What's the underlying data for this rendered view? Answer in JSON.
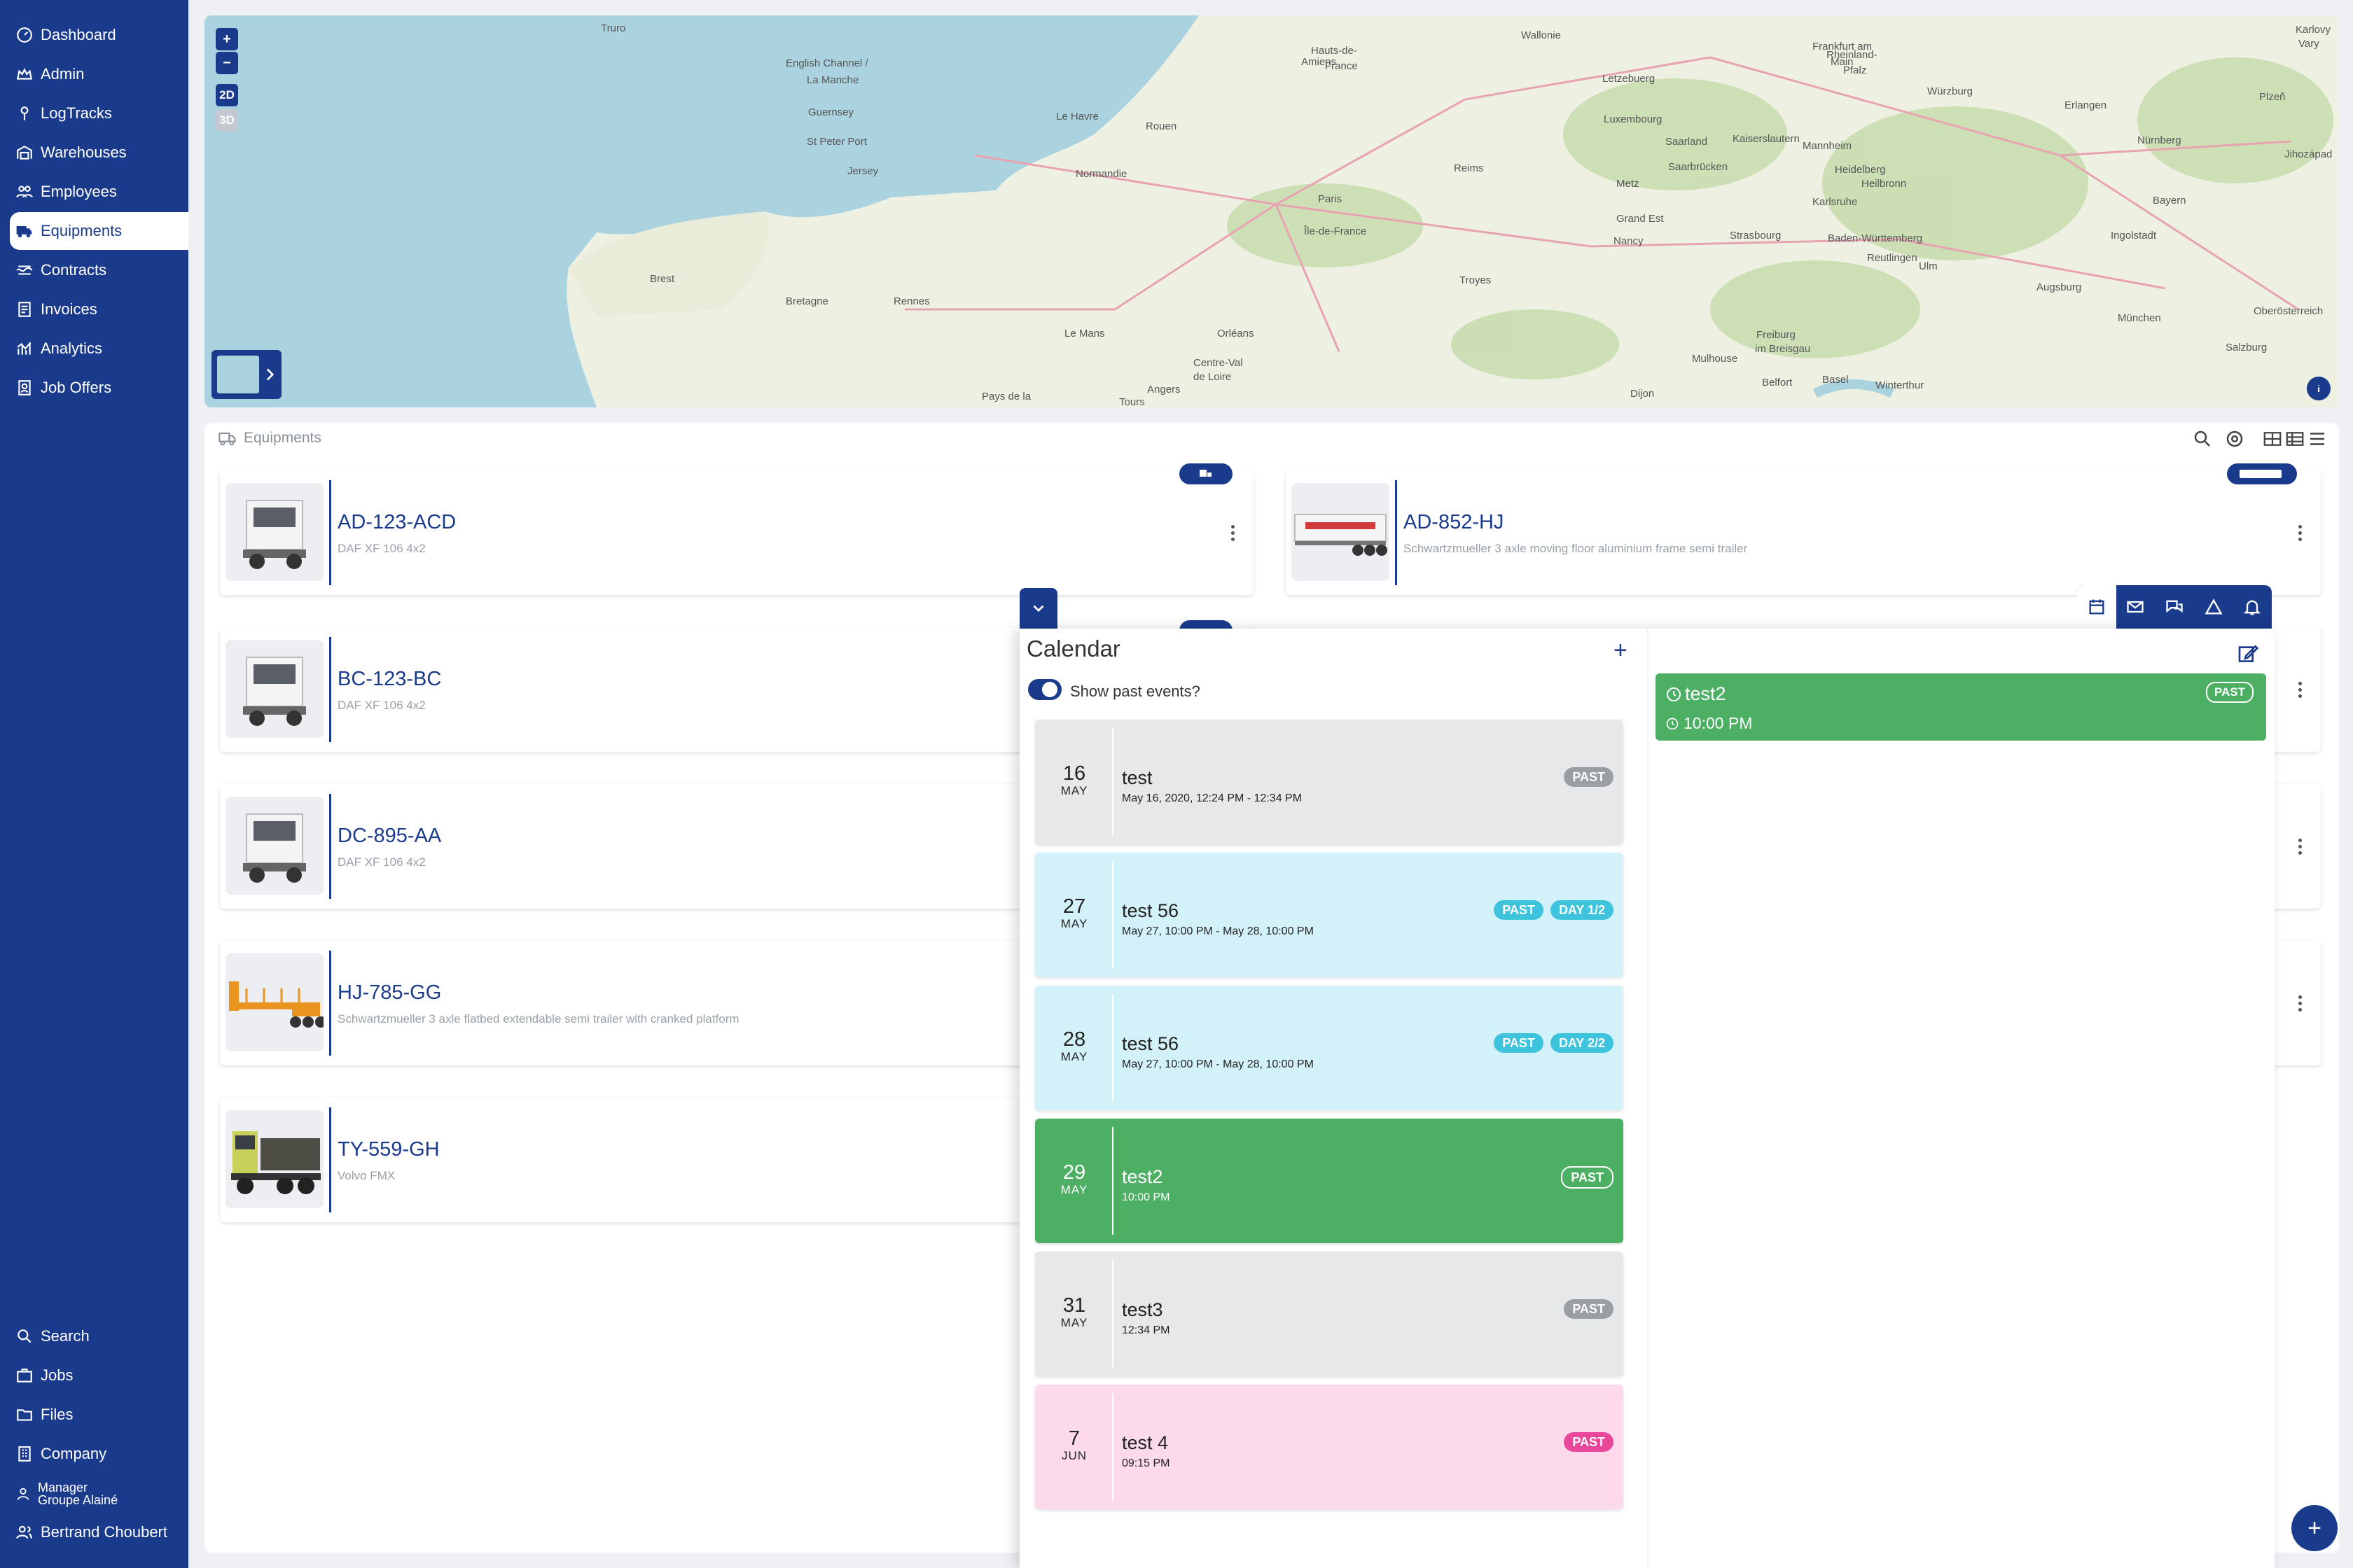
{
  "sidebar": {
    "nav": [
      {
        "label": "Dashboard",
        "icon": "dashboard-icon"
      },
      {
        "label": "Admin",
        "icon": "crown-icon"
      },
      {
        "label": "LogTracks",
        "icon": "pin-icon"
      },
      {
        "label": "Warehouses",
        "icon": "warehouse-icon"
      },
      {
        "label": "Employees",
        "icon": "employees-icon"
      },
      {
        "label": "Equipments",
        "icon": "truck-icon"
      },
      {
        "label": "Contracts",
        "icon": "contract-icon"
      },
      {
        "label": "Invoices",
        "icon": "invoice-icon"
      },
      {
        "label": "Analytics",
        "icon": "analytics-icon"
      },
      {
        "label": "Job Offers",
        "icon": "job-offers-icon"
      }
    ],
    "bottom": [
      {
        "label": "Search",
        "icon": "search-icon"
      },
      {
        "label": "Jobs",
        "icon": "briefcase-icon"
      },
      {
        "label": "Files",
        "icon": "folder-icon"
      },
      {
        "label": "Company",
        "icon": "building-icon"
      }
    ],
    "manager": {
      "line1": "Manager",
      "line2": "Groupe Alainé"
    },
    "user": {
      "name": "Bertrand Choubert"
    }
  },
  "map": {
    "zoom_in": "+",
    "zoom_out": "−",
    "mode_2d": "2D",
    "mode_3d": "3D",
    "places": [
      {
        "name": "Truro"
      },
      {
        "name": "English Channel /"
      },
      {
        "name": "La Manche"
      },
      {
        "name": "Guernsey"
      },
      {
        "name": "St Peter Port"
      },
      {
        "name": "Jersey"
      },
      {
        "name": "Le Havre"
      },
      {
        "name": "Rouen"
      },
      {
        "name": "Amiens"
      },
      {
        "name": "Hauts-de-"
      },
      {
        "name": "France"
      },
      {
        "name": "Paris"
      },
      {
        "name": "Île-de-France"
      },
      {
        "name": "Normandie"
      },
      {
        "name": "Brest"
      },
      {
        "name": "Bretagne"
      },
      {
        "name": "Rennes"
      },
      {
        "name": "Le Mans"
      },
      {
        "name": "Orléans"
      },
      {
        "name": "Centre-Val"
      },
      {
        "name": "de Loire"
      },
      {
        "name": "Angers"
      },
      {
        "name": "Tours"
      },
      {
        "name": "Pays de la"
      },
      {
        "name": "Troyes"
      },
      {
        "name": "Reims"
      },
      {
        "name": "Metz"
      },
      {
        "name": "Nancy"
      },
      {
        "name": "Strasbourg"
      },
      {
        "name": "Grand Est"
      },
      {
        "name": "Luxembourg"
      },
      {
        "name": "Letzebuerg"
      },
      {
        "name": "Wallonie"
      },
      {
        "name": "Frankfurt am"
      },
      {
        "name": "Main"
      },
      {
        "name": "Würzburg"
      },
      {
        "name": "Rheinland-"
      },
      {
        "name": "Pfalz"
      },
      {
        "name": "Saarland"
      },
      {
        "name": "Saarbrücken"
      },
      {
        "name": "Kaiserslautern"
      },
      {
        "name": "Mannheim"
      },
      {
        "name": "Heidelberg"
      },
      {
        "name": "Heilbronn"
      },
      {
        "name": "Karlsruhe"
      },
      {
        "name": "Baden-Württemberg"
      },
      {
        "name": "Reutlingen"
      },
      {
        "name": "Ulm"
      },
      {
        "name": "Augsburg"
      },
      {
        "name": "München"
      },
      {
        "name": "Ingolstadt"
      },
      {
        "name": "Nürnberg"
      },
      {
        "name": "Erlangen"
      },
      {
        "name": "Plzeň"
      },
      {
        "name": "Karlovy"
      },
      {
        "name": "Vary"
      },
      {
        "name": "Jihozápad"
      },
      {
        "name": "Bayern"
      },
      {
        "name": "Oberösterreich"
      },
      {
        "name": "Salzburg"
      },
      {
        "name": "Freiburg"
      },
      {
        "name": "im Breisgau"
      },
      {
        "name": "Mulhouse"
      },
      {
        "name": "Basel"
      },
      {
        "name": "Winterthur"
      },
      {
        "name": "Belfort"
      },
      {
        "name": "Dijon"
      }
    ]
  },
  "equipments": {
    "title": "Equipments",
    "left": [
      {
        "plate": "AD-123-ACD",
        "model": "DAF XF 106 4x2",
        "kind": "truck"
      },
      {
        "plate": "BC-123-BC",
        "model": "DAF XF 106 4x2",
        "kind": "truck"
      },
      {
        "plate": "DC-895-AA",
        "model": "DAF XF 106 4x2",
        "kind": "truck"
      },
      {
        "plate": "HJ-785-GG",
        "model": "Schwartzmueller 3 axle flatbed extendable semi trailer with cranked platform",
        "kind": "flatbed"
      },
      {
        "plate": "TY-559-GH",
        "model": "Volvo FMX",
        "kind": "tipper"
      }
    ],
    "right": [
      {
        "plate": "AD-852-HJ",
        "model": "Schwartzmueller 3 axle moving floor aluminium frame semi trailer",
        "kind": "trailer",
        "brand": "SCHWARTZMUELLER"
      }
    ]
  },
  "calendar": {
    "title": "Calendar",
    "add": "+",
    "toggle_label": "Show past events?",
    "events": [
      {
        "day": "16",
        "month": "MAY",
        "title": "test",
        "sub": "May 16, 2020, 12:24 PM - 12:34 PM",
        "badges": [
          "PAST"
        ],
        "theme": "gray"
      },
      {
        "day": "27",
        "month": "MAY",
        "title": "test 56",
        "sub": "May 27, 10:00 PM - May 28, 10:00 PM",
        "badges": [
          "PAST",
          "DAY 1/2"
        ],
        "theme": "cyan"
      },
      {
        "day": "28",
        "month": "MAY",
        "title": "test 56",
        "sub": "May 27, 10:00 PM - May 28, 10:00 PM",
        "badges": [
          "PAST",
          "DAY 2/2"
        ],
        "theme": "cyan"
      },
      {
        "day": "29",
        "month": "MAY",
        "title": "test2",
        "sub": "10:00 PM",
        "badges": [
          "PAST"
        ],
        "theme": "green"
      },
      {
        "day": "31",
        "month": "MAY",
        "title": "test3",
        "sub": "12:34 PM",
        "badges": [
          "PAST"
        ],
        "theme": "gray"
      },
      {
        "day": "7",
        "month": "JUN",
        "title": "test 4",
        "sub": "09:15 PM",
        "badges": [
          "PAST"
        ],
        "theme": "pink"
      }
    ],
    "detail": {
      "title": "test2",
      "time": "10:00 PM",
      "badge": "PAST"
    }
  },
  "colors": {
    "brand": "#1a3a8c",
    "green": "#4caf63",
    "cyan": "#d3f1f8",
    "cyan_badge": "#3ec3dd",
    "gray": "#e7e8ea",
    "gray_badge": "#9b9ea3",
    "pink": "#fdd9ec",
    "pink_badge": "#e9489a"
  }
}
